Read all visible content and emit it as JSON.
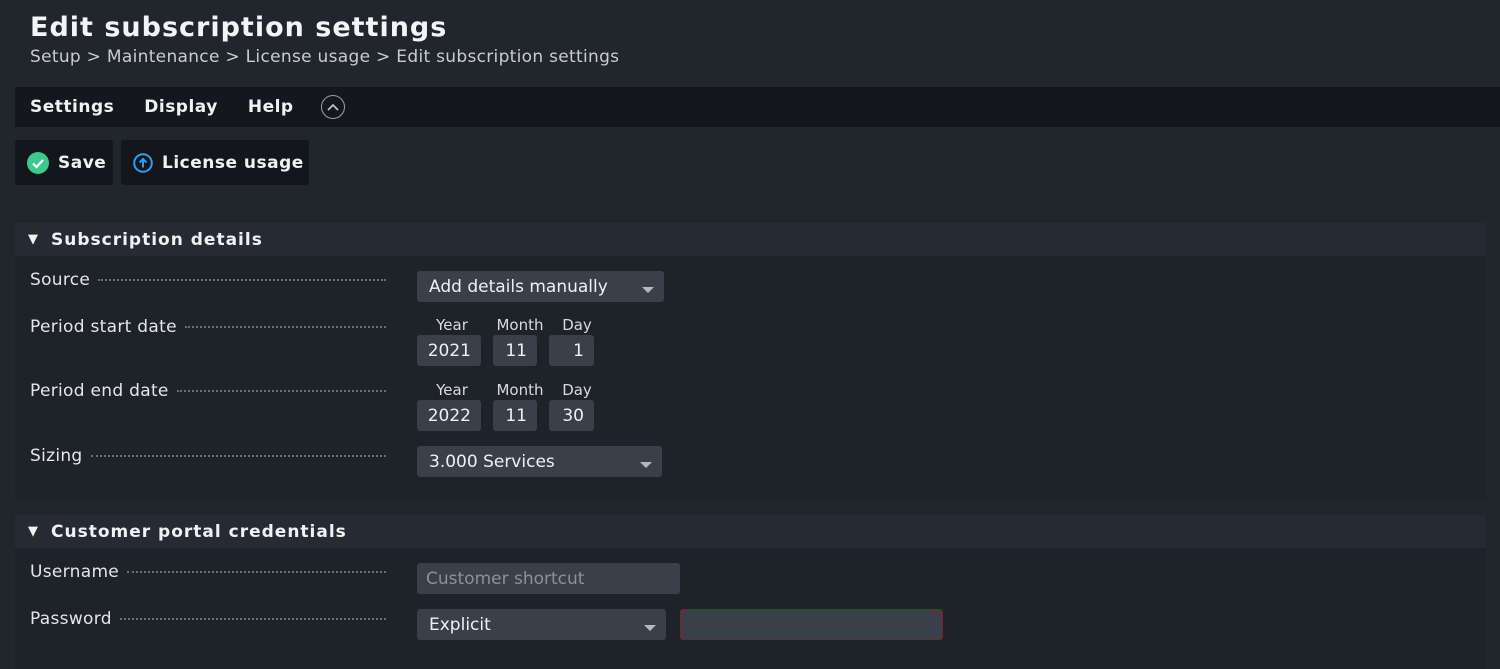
{
  "header": {
    "title": "Edit subscription settings",
    "breadcrumb": "Setup > Maintenance > License usage > Edit subscription settings"
  },
  "menu": {
    "items": [
      {
        "label": "Settings"
      },
      {
        "label": "Display"
      },
      {
        "label": "Help"
      }
    ],
    "collapse_icon": "chevron-up-circle-icon"
  },
  "toolbar": {
    "save_label": "Save",
    "save_icon": "checkmark-circle-icon",
    "save_color": "#3cc98a",
    "license_label": "License usage",
    "license_icon": "arrow-up-circle-icon",
    "license_color": "#2f9df5"
  },
  "subscription": {
    "title": "Subscription details",
    "source": {
      "label": "Source",
      "value": "Add details manually"
    },
    "start": {
      "label": "Period start date",
      "year_label": "Year",
      "month_label": "Month",
      "day_label": "Day",
      "year": "2021",
      "month": "11",
      "day": "1"
    },
    "end": {
      "label": "Period end date",
      "year_label": "Year",
      "month_label": "Month",
      "day_label": "Day",
      "year": "2022",
      "month": "11",
      "day": "30"
    },
    "sizing": {
      "label": "Sizing",
      "value": "3.000 Services"
    }
  },
  "credentials": {
    "title": "Customer portal credentials",
    "username": {
      "label": "Username",
      "placeholder": "Customer shortcut"
    },
    "password": {
      "label": "Password",
      "mode": "Explicit",
      "value": ""
    }
  }
}
